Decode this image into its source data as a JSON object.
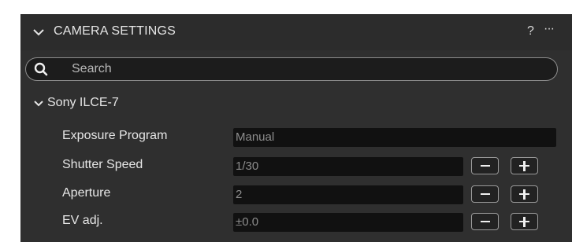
{
  "header": {
    "title": "CAMERA SETTINGS",
    "help_label": "?",
    "more_label": "···"
  },
  "search": {
    "placeholder": "Search"
  },
  "group": {
    "label": "Sony ILCE-7"
  },
  "rows": [
    {
      "label": "Exposure Program",
      "value": "Manual"
    },
    {
      "label": "Shutter Speed",
      "value": "1/30",
      "minus": "decrease",
      "plus": "increase"
    },
    {
      "label": "Aperture",
      "value": "2",
      "minus": "decrease",
      "plus": "increase"
    },
    {
      "label": "EV adj.",
      "value": "±0.0",
      "minus": "decrease",
      "plus": "increase"
    }
  ],
  "icons": {
    "collapse_header": "chevron-down-icon",
    "collapse_group": "chevron-down-icon",
    "search": "search-icon",
    "minus": "minus-icon",
    "plus": "plus-icon"
  },
  "colors": {
    "panel_bg": "#2f2f2f",
    "field_bg": "#111111",
    "text": "#e6e6e6",
    "value_text": "#8d8d8d"
  }
}
